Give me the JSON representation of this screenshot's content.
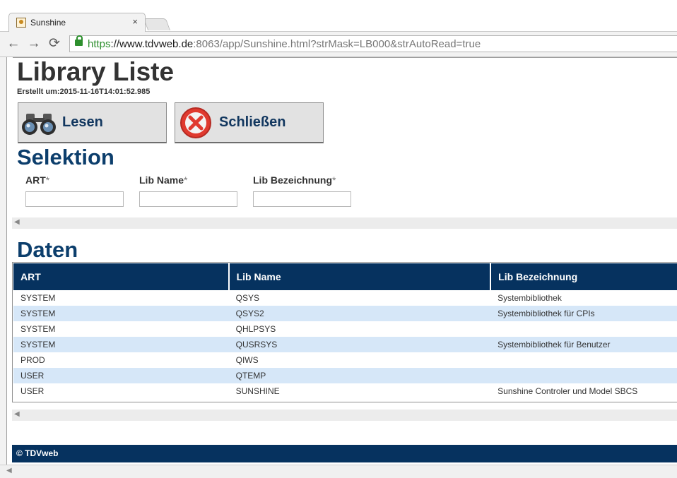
{
  "browser": {
    "tab_title": "Sunshine",
    "tab_close": "×",
    "url_scheme": "https",
    "url_host": "://www.tdvweb.de",
    "url_rest": ":8063/app/Sunshine.html?strMask=LB000&strAutoRead=true",
    "nav_back": "←",
    "nav_forward": "→",
    "nav_reload": "⟳"
  },
  "page": {
    "title": "Library Liste",
    "created": "Erstellt um:2015-11-16T14:01:52.985"
  },
  "actions": {
    "read_label": "Lesen",
    "close_label": "Schließen"
  },
  "selection": {
    "title": "Selektion",
    "fields": [
      {
        "label": "ART",
        "required_mark": "*",
        "value": ""
      },
      {
        "label": "Lib Name",
        "required_mark": "*",
        "value": ""
      },
      {
        "label": "Lib Bezeichnung",
        "required_mark": "*",
        "value": ""
      }
    ]
  },
  "data": {
    "title": "Daten",
    "columns": [
      "ART",
      "Lib Name",
      "Lib Bezeichnung"
    ],
    "rows": [
      [
        "SYSTEM",
        "QSYS",
        "Systembibliothek"
      ],
      [
        "SYSTEM",
        "QSYS2",
        "Systembibliothek für CPIs"
      ],
      [
        "SYSTEM",
        "QHLPSYS",
        ""
      ],
      [
        "SYSTEM",
        "QUSRSYS",
        "Systembibliothek für Benutzer"
      ],
      [
        "PROD",
        "QIWS",
        ""
      ],
      [
        "USER",
        "QTEMP",
        ""
      ],
      [
        "USER",
        "SUNSHINE",
        "Sunshine Controler und Model SBCS"
      ]
    ]
  },
  "footer": {
    "text": "© TDVweb"
  },
  "colors": {
    "header_bg": "#06325f",
    "heading": "#0c3e6c",
    "row_alt": "#d6e7f8",
    "close_icon": "#e03a2f"
  }
}
